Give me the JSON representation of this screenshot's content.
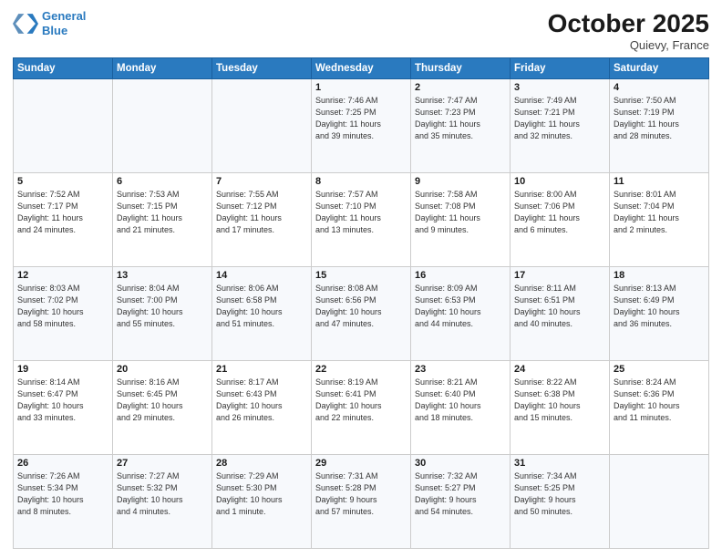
{
  "header": {
    "logo_line1": "General",
    "logo_line2": "Blue",
    "month": "October 2025",
    "location": "Quievy, France"
  },
  "weekdays": [
    "Sunday",
    "Monday",
    "Tuesday",
    "Wednesday",
    "Thursday",
    "Friday",
    "Saturday"
  ],
  "weeks": [
    [
      {
        "day": "",
        "text": ""
      },
      {
        "day": "",
        "text": ""
      },
      {
        "day": "",
        "text": ""
      },
      {
        "day": "1",
        "text": "Sunrise: 7:46 AM\nSunset: 7:25 PM\nDaylight: 11 hours\nand 39 minutes."
      },
      {
        "day": "2",
        "text": "Sunrise: 7:47 AM\nSunset: 7:23 PM\nDaylight: 11 hours\nand 35 minutes."
      },
      {
        "day": "3",
        "text": "Sunrise: 7:49 AM\nSunset: 7:21 PM\nDaylight: 11 hours\nand 32 minutes."
      },
      {
        "day": "4",
        "text": "Sunrise: 7:50 AM\nSunset: 7:19 PM\nDaylight: 11 hours\nand 28 minutes."
      }
    ],
    [
      {
        "day": "5",
        "text": "Sunrise: 7:52 AM\nSunset: 7:17 PM\nDaylight: 11 hours\nand 24 minutes."
      },
      {
        "day": "6",
        "text": "Sunrise: 7:53 AM\nSunset: 7:15 PM\nDaylight: 11 hours\nand 21 minutes."
      },
      {
        "day": "7",
        "text": "Sunrise: 7:55 AM\nSunset: 7:12 PM\nDaylight: 11 hours\nand 17 minutes."
      },
      {
        "day": "8",
        "text": "Sunrise: 7:57 AM\nSunset: 7:10 PM\nDaylight: 11 hours\nand 13 minutes."
      },
      {
        "day": "9",
        "text": "Sunrise: 7:58 AM\nSunset: 7:08 PM\nDaylight: 11 hours\nand 9 minutes."
      },
      {
        "day": "10",
        "text": "Sunrise: 8:00 AM\nSunset: 7:06 PM\nDaylight: 11 hours\nand 6 minutes."
      },
      {
        "day": "11",
        "text": "Sunrise: 8:01 AM\nSunset: 7:04 PM\nDaylight: 11 hours\nand 2 minutes."
      }
    ],
    [
      {
        "day": "12",
        "text": "Sunrise: 8:03 AM\nSunset: 7:02 PM\nDaylight: 10 hours\nand 58 minutes."
      },
      {
        "day": "13",
        "text": "Sunrise: 8:04 AM\nSunset: 7:00 PM\nDaylight: 10 hours\nand 55 minutes."
      },
      {
        "day": "14",
        "text": "Sunrise: 8:06 AM\nSunset: 6:58 PM\nDaylight: 10 hours\nand 51 minutes."
      },
      {
        "day": "15",
        "text": "Sunrise: 8:08 AM\nSunset: 6:56 PM\nDaylight: 10 hours\nand 47 minutes."
      },
      {
        "day": "16",
        "text": "Sunrise: 8:09 AM\nSunset: 6:53 PM\nDaylight: 10 hours\nand 44 minutes."
      },
      {
        "day": "17",
        "text": "Sunrise: 8:11 AM\nSunset: 6:51 PM\nDaylight: 10 hours\nand 40 minutes."
      },
      {
        "day": "18",
        "text": "Sunrise: 8:13 AM\nSunset: 6:49 PM\nDaylight: 10 hours\nand 36 minutes."
      }
    ],
    [
      {
        "day": "19",
        "text": "Sunrise: 8:14 AM\nSunset: 6:47 PM\nDaylight: 10 hours\nand 33 minutes."
      },
      {
        "day": "20",
        "text": "Sunrise: 8:16 AM\nSunset: 6:45 PM\nDaylight: 10 hours\nand 29 minutes."
      },
      {
        "day": "21",
        "text": "Sunrise: 8:17 AM\nSunset: 6:43 PM\nDaylight: 10 hours\nand 26 minutes."
      },
      {
        "day": "22",
        "text": "Sunrise: 8:19 AM\nSunset: 6:41 PM\nDaylight: 10 hours\nand 22 minutes."
      },
      {
        "day": "23",
        "text": "Sunrise: 8:21 AM\nSunset: 6:40 PM\nDaylight: 10 hours\nand 18 minutes."
      },
      {
        "day": "24",
        "text": "Sunrise: 8:22 AM\nSunset: 6:38 PM\nDaylight: 10 hours\nand 15 minutes."
      },
      {
        "day": "25",
        "text": "Sunrise: 8:24 AM\nSunset: 6:36 PM\nDaylight: 10 hours\nand 11 minutes."
      }
    ],
    [
      {
        "day": "26",
        "text": "Sunrise: 7:26 AM\nSunset: 5:34 PM\nDaylight: 10 hours\nand 8 minutes."
      },
      {
        "day": "27",
        "text": "Sunrise: 7:27 AM\nSunset: 5:32 PM\nDaylight: 10 hours\nand 4 minutes."
      },
      {
        "day": "28",
        "text": "Sunrise: 7:29 AM\nSunset: 5:30 PM\nDaylight: 10 hours\nand 1 minute."
      },
      {
        "day": "29",
        "text": "Sunrise: 7:31 AM\nSunset: 5:28 PM\nDaylight: 9 hours\nand 57 minutes."
      },
      {
        "day": "30",
        "text": "Sunrise: 7:32 AM\nSunset: 5:27 PM\nDaylight: 9 hours\nand 54 minutes."
      },
      {
        "day": "31",
        "text": "Sunrise: 7:34 AM\nSunset: 5:25 PM\nDaylight: 9 hours\nand 50 minutes."
      },
      {
        "day": "",
        "text": ""
      }
    ]
  ]
}
